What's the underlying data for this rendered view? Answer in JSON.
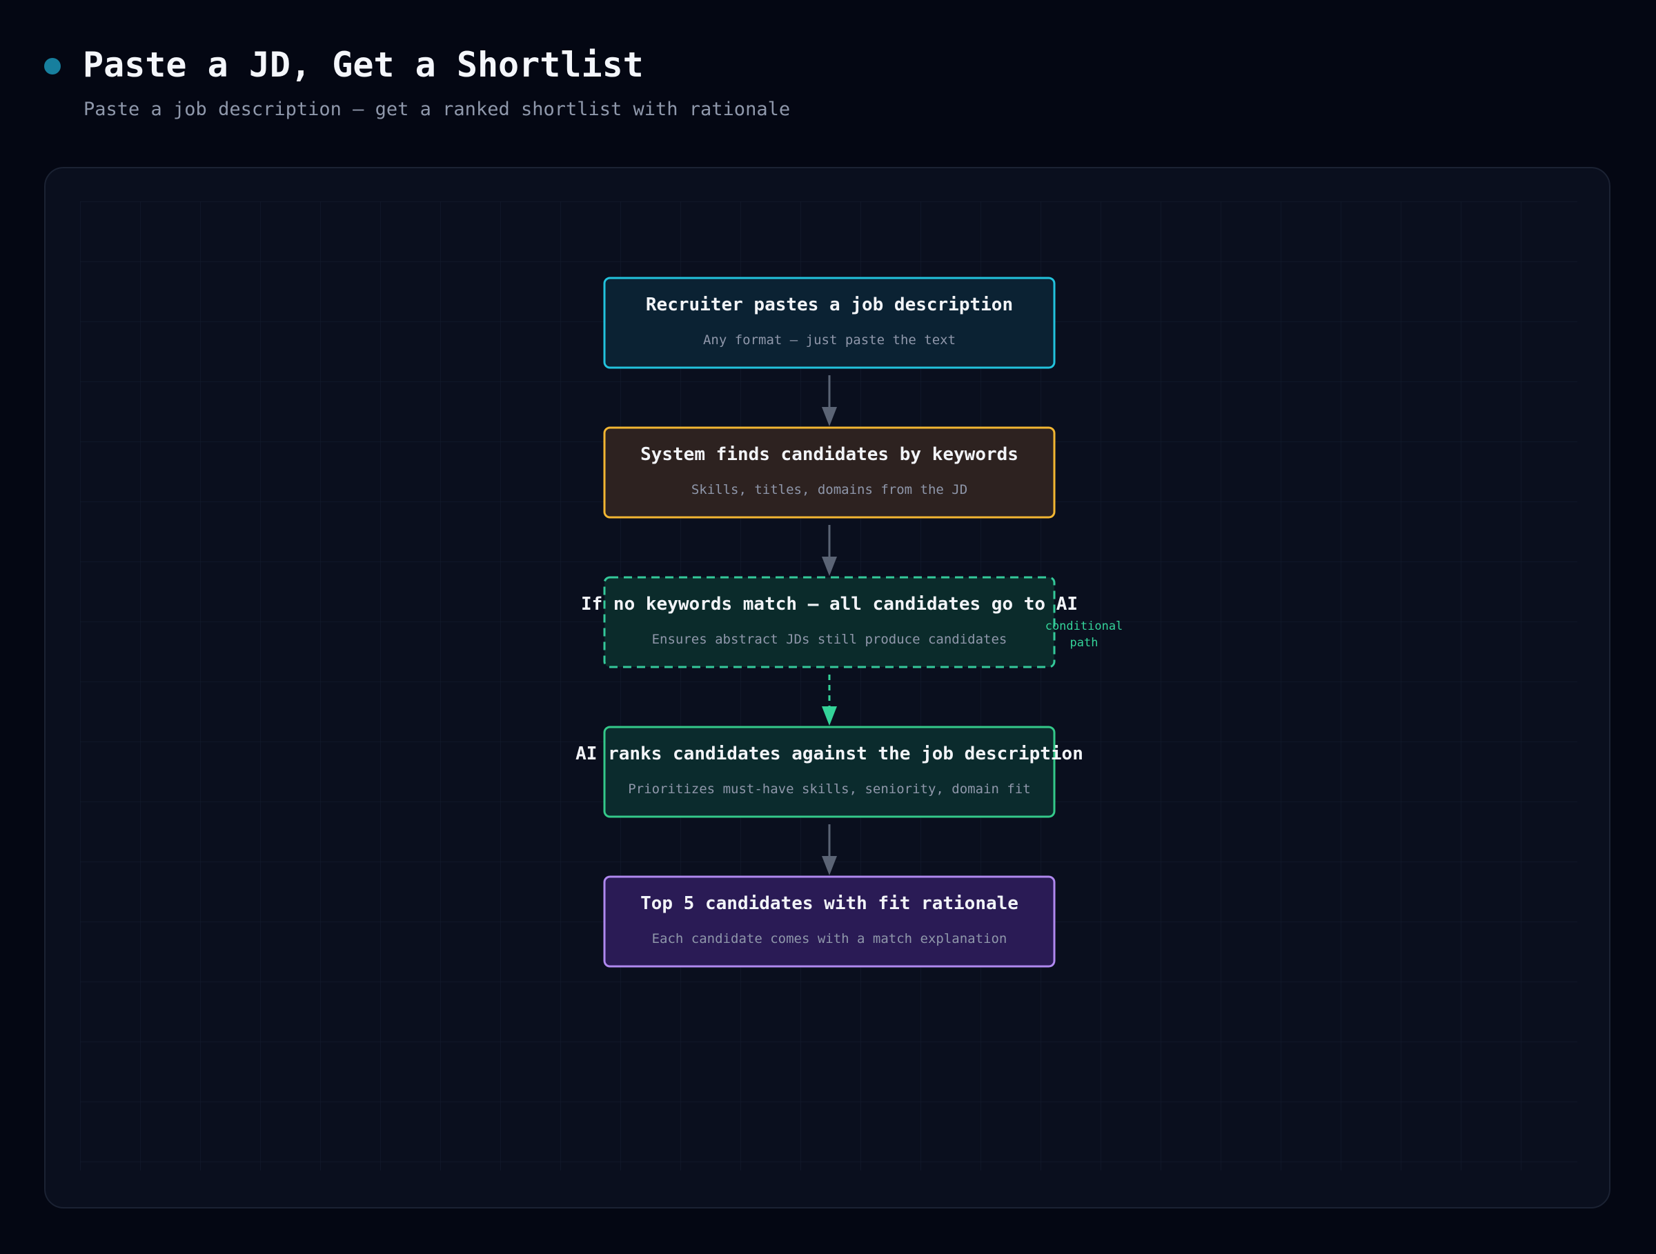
{
  "header": {
    "title": "Paste a JD, Get a Shortlist",
    "subtitle": "Paste a job description — get a ranked shortlist with rationale"
  },
  "colors": {
    "page_background": "#040713",
    "panel_background": "#0a0f1e",
    "accent_dot": "#177f9e",
    "edge_default": "#5b6475",
    "edge_conditional": "#34d399"
  },
  "diagram": {
    "nodes": [
      {
        "id": "paste",
        "title": "Recruiter pastes a job description",
        "desc": "Any format — just paste the text",
        "border": "#22c3dd",
        "fill": "#0b2233",
        "dashed": false
      },
      {
        "id": "keywords",
        "title": "System finds candidates by keywords",
        "desc": "Skills, titles, domains from the JD",
        "border": "#f2b632",
        "fill": "#2d2220",
        "dashed": false
      },
      {
        "id": "fallback",
        "title": "If no keywords match — all candidates go to AI",
        "desc": "Ensures abstract JDs still produce candidates",
        "border": "#34c99a",
        "fill": "#0b2b2b",
        "dashed": true
      },
      {
        "id": "rank",
        "title": "AI ranks candidates against the job description",
        "desc": "Prioritizes must-have skills, seniority, domain fit",
        "border": "#34c98a",
        "fill": "#0b2b2d",
        "dashed": false
      },
      {
        "id": "top5",
        "title": "Top 5 candidates with fit rationale",
        "desc": "Each candidate comes with a match explanation",
        "border": "#b089f0",
        "fill": "#2a1b55",
        "dashed": false
      }
    ],
    "edges": [
      {
        "from": "paste",
        "to": "keywords",
        "dashed": false
      },
      {
        "from": "keywords",
        "to": "fallback",
        "dashed": false
      },
      {
        "from": "fallback",
        "to": "rank",
        "dashed": true
      },
      {
        "from": "rank",
        "to": "top5",
        "dashed": false
      }
    ],
    "edge_labels": [
      {
        "node": "fallback",
        "lines": [
          "conditional",
          "path"
        ]
      }
    ]
  }
}
